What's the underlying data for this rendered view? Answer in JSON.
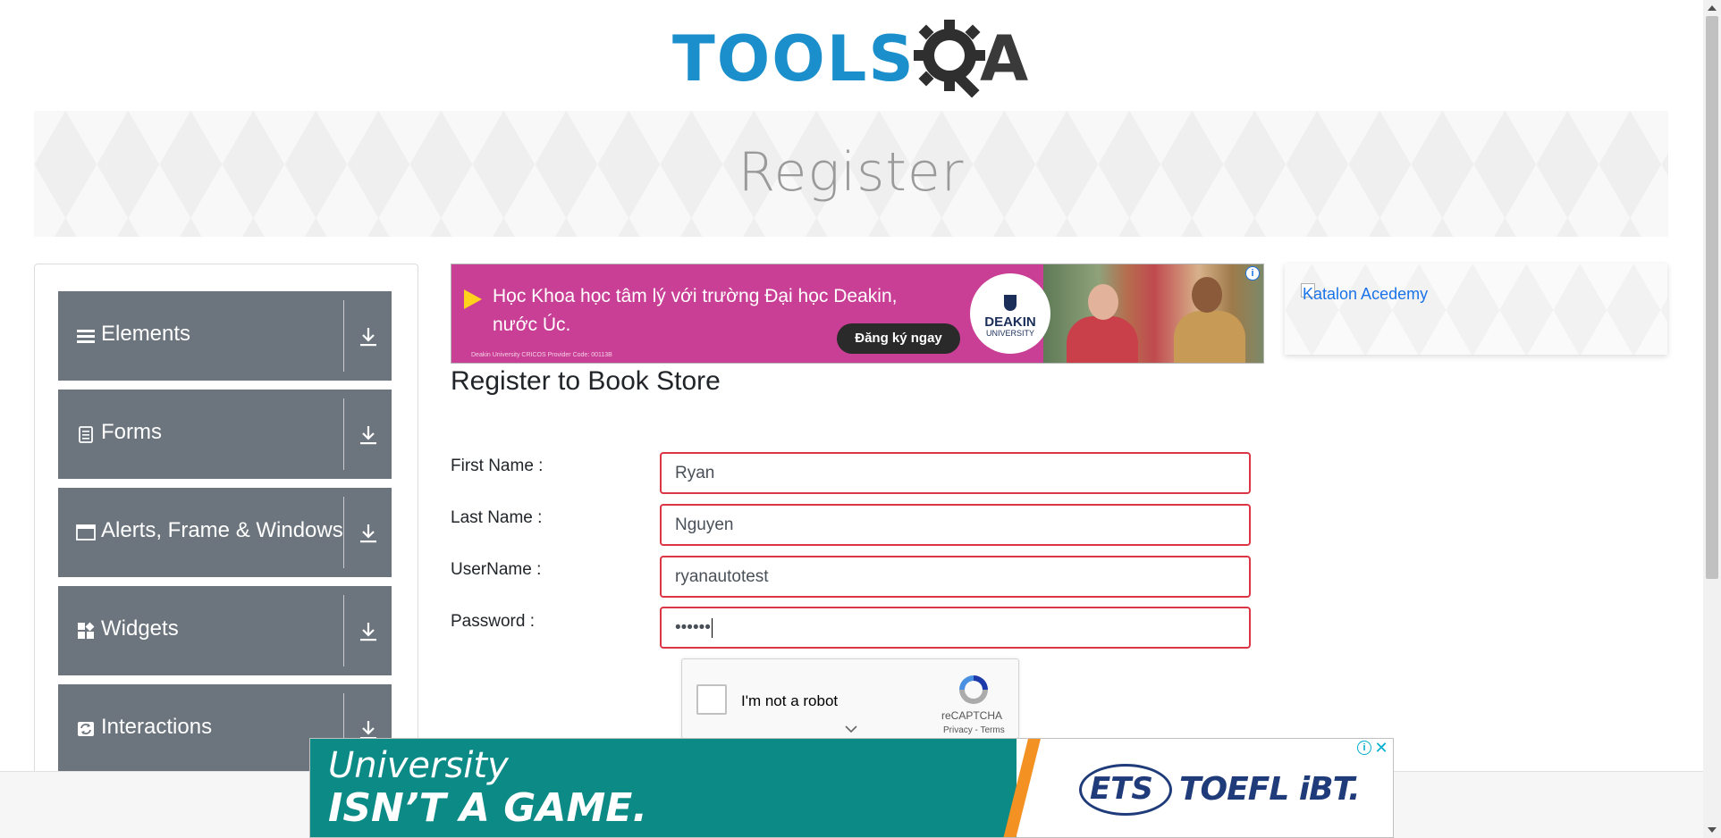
{
  "header": {
    "logo_text": "TOOLS",
    "logo_text_accent": "A",
    "logo_alt": "TOOLSQA"
  },
  "banner": {
    "title": "Register"
  },
  "sidebar": {
    "groups": [
      {
        "label": "Elements",
        "icon": "hamburger-icon"
      },
      {
        "label": "Forms",
        "icon": "document-icon"
      },
      {
        "label": "Alerts, Frame & Windows",
        "icon": "window-icon"
      },
      {
        "label": "Widgets",
        "icon": "widgets-icon"
      },
      {
        "label": "Interactions",
        "icon": "refresh-icon"
      }
    ]
  },
  "ad_top": {
    "line1": "Học Khoa học tâm lý với trường Đại học Deakin,",
    "line2": "nước Úc.",
    "cta": "Đăng ký ngay",
    "fine_print": "Deakin University CRICOS Provider Code: 00113B",
    "brand_name": "DEAKIN",
    "brand_sub": "UNIVERSITY",
    "info_glyph": "i"
  },
  "side_ad": {
    "alt_text": "Katalon Acedemy"
  },
  "form": {
    "title": "Register to Book Store",
    "fields": [
      {
        "label": "First Name :",
        "value": "Ryan"
      },
      {
        "label": "Last Name :",
        "value": "Nguyen"
      },
      {
        "label": "UserName :",
        "value": "ryanautotest"
      },
      {
        "label": "Password :",
        "value": "••••••"
      }
    ]
  },
  "recaptcha": {
    "label": "I'm not a robot",
    "brand": "reCAPTCHA",
    "links": "Privacy - Terms"
  },
  "ad_bottom": {
    "line1": "University",
    "line2": "ISN’T A GAME.",
    "ets": "ETS",
    "product": "TOEFL iBT.",
    "info_glyph": "i",
    "close_glyph": "✕"
  },
  "colors": {
    "primary_blue": "#1a8fcb",
    "sidebar_gray": "#6c757d",
    "error_red": "#dc3545",
    "ad_pink": "#c93f95",
    "ad_teal": "#0c8a86"
  }
}
